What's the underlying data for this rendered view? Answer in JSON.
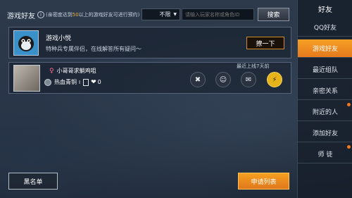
{
  "header": {
    "title": "游戏好友",
    "info_icon": "i",
    "note_prefix": "(亲密度达到",
    "note_highlight": "50",
    "note_suffix": "以上的游戏好友可进行预约)",
    "filter_value": "不限",
    "search_placeholder": "请输入玩家名称或角色ID",
    "search_label": "搜索"
  },
  "bot": {
    "name": "游戏小悦",
    "desc": "特种兵专属伴侣，在线解答所有疑问～",
    "chat_label": "撩一下"
  },
  "friend": {
    "name": "小哥哥求躺鸡咀",
    "gender_icon": "♀",
    "rank_label": "热血青铜",
    "rank_tier": "I",
    "likes": "0",
    "last_login": "最近上线7天前"
  },
  "bottom": {
    "blacklist_label": "黑名单",
    "requests_label": "申请列表"
  },
  "sidebar": {
    "title": "好友",
    "items": [
      {
        "label": "QQ好友"
      },
      {
        "label": "游戏好友"
      },
      {
        "label": "最近组队"
      },
      {
        "label": "亲密关系"
      },
      {
        "label": "附近的人"
      },
      {
        "label": "添加好友"
      },
      {
        "label": "师  徒"
      }
    ]
  },
  "colors": {
    "accent": "#f59a22",
    "highlight": "#f3b133"
  }
}
